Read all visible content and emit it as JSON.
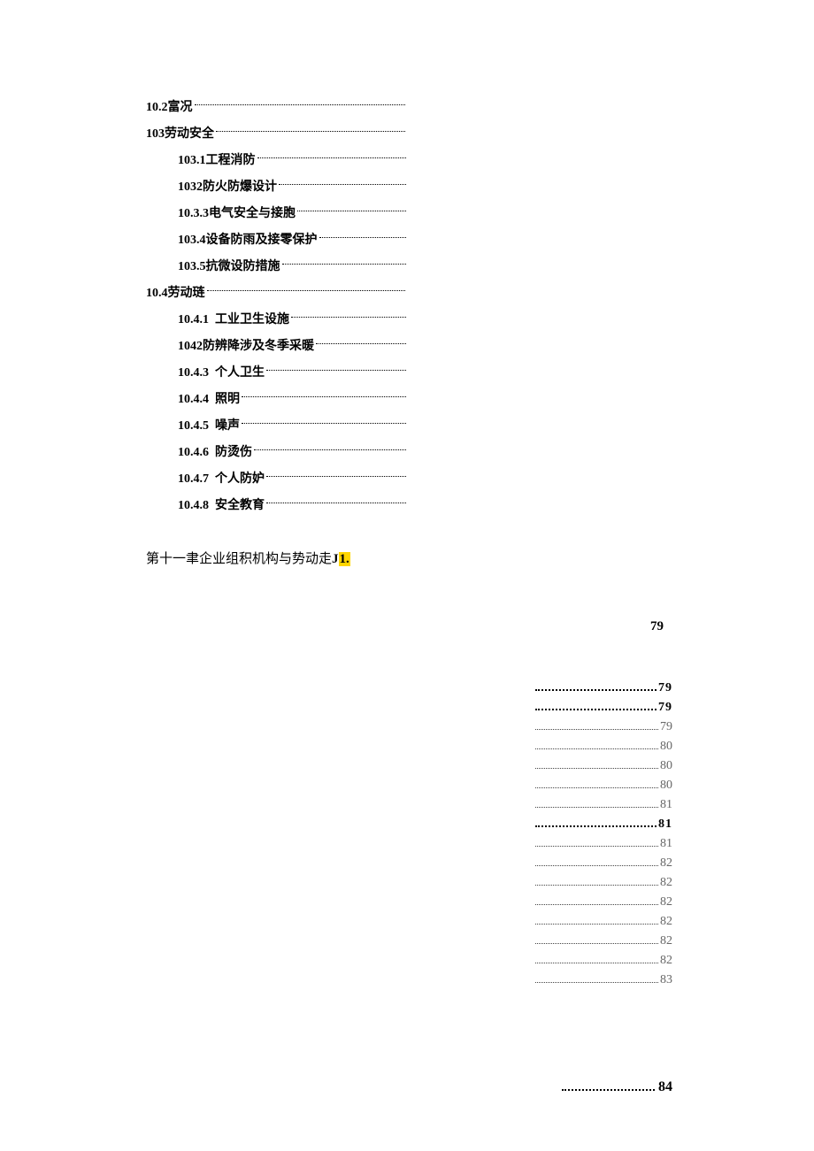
{
  "toc_upper": [
    {
      "level": 1,
      "num": "10.2",
      "text": "富况"
    },
    {
      "level": 1,
      "num": "103",
      "text": "劳动安全"
    },
    {
      "level": 2,
      "num": "103.1",
      "text": "工程消防"
    },
    {
      "level": 2,
      "num": "1032",
      "text": "防火防爆设计"
    },
    {
      "level": 2,
      "num": "10.3.3",
      "text": "电气安全与接胞"
    },
    {
      "level": 2,
      "num": "103.4",
      "text": "设备防雨及接零保护"
    },
    {
      "level": 2,
      "num": "103.5",
      "text": "抗微设防措施"
    },
    {
      "level": 1,
      "num": "10.4",
      "text": "劳动琏"
    },
    {
      "level": 2,
      "num": "10.4.1",
      "text": "工业卫生设施",
      "space": true
    },
    {
      "level": 2,
      "num": "1042",
      "text": "防辨降涉及冬季采暖"
    },
    {
      "level": 2,
      "num": "10.4.3",
      "text": "个人卫生",
      "space": true
    },
    {
      "level": 2,
      "num": "10.4.4",
      "text": "照明",
      "space": true
    },
    {
      "level": 2,
      "num": "10.4.5",
      "text": "噪声",
      "space": true
    },
    {
      "level": 2,
      "num": "10.4.6",
      "text": "防烫伤",
      "space": true
    },
    {
      "level": 2,
      "num": "10.4.7",
      "text": "个人防妒",
      "space": true
    },
    {
      "level": 2,
      "num": "10.4.8",
      "text": "安全教育",
      "space": true
    }
  ],
  "chapter_line_prefix": "第十一聿企业组积机构与势动走",
  "chapter_line_suffix": "J",
  "chapter_highlight": "1.",
  "top_right_page": "79",
  "right_pages": [
    {
      "pg": "79",
      "style": "bold",
      "wide": true
    },
    {
      "pg": "79",
      "style": "bold",
      "wide": true
    },
    {
      "pg": "79",
      "style": "grey"
    },
    {
      "pg": "80",
      "style": "grey"
    },
    {
      "pg": "80",
      "style": "grey"
    },
    {
      "pg": "80",
      "style": "grey"
    },
    {
      "pg": "81",
      "style": "grey"
    },
    {
      "pg": "81",
      "style": "bold",
      "wide": true
    },
    {
      "pg": "81",
      "style": "grey"
    },
    {
      "pg": "82",
      "style": "grey"
    },
    {
      "pg": "82",
      "style": "grey"
    },
    {
      "pg": "82",
      "style": "grey"
    },
    {
      "pg": "82",
      "style": "grey"
    },
    {
      "pg": "82",
      "style": "grey"
    },
    {
      "pg": "82",
      "style": "grey"
    },
    {
      "pg": "83",
      "style": "grey"
    }
  ],
  "bottom_page": "84"
}
